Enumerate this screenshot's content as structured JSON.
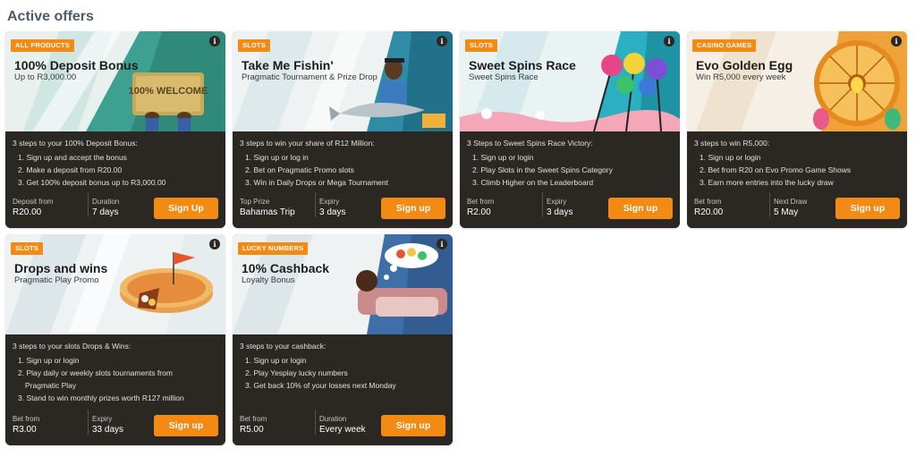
{
  "page": {
    "title": "Active offers"
  },
  "colors": {
    "accent": "#f28a14",
    "card_dark": "#2b2723"
  },
  "offers": [
    {
      "badge": "ALL PRODUCTS",
      "title": "100% Deposit Bonus",
      "subtitle": "Up to R3,000.00",
      "steps_head": "3 steps to your 100% Deposit Bonus:",
      "steps": [
        "1. Sign up and accept the bonus",
        "2. Make a deposit from R20.00",
        "3. Get 100% deposit bonus up to R3,000.00"
      ],
      "meta": [
        {
          "label": "Deposit from",
          "value": "R20.00"
        },
        {
          "label": "Duration",
          "value": "7 days"
        }
      ],
      "cta": "Sign Up",
      "art": "welcome-mat-image",
      "mat_text": "100% WELCOME"
    },
    {
      "badge": "SLOTS",
      "title": "Take Me Fishin'",
      "subtitle": "Pragmatic Tournament & Prize Drop",
      "steps_head": "3 steps to win your share of R12 Million:",
      "steps": [
        "1. Sign up or log in",
        "2. Bet on Pragmatic Promo slots",
        "3. Win in Daily Drops or Mega Tournament"
      ],
      "meta": [
        {
          "label": "Top Prize",
          "value": "Bahamas Trip"
        },
        {
          "label": "Expiry",
          "value": "3 days"
        }
      ],
      "cta": "Sign up",
      "art": "fisherman-image"
    },
    {
      "badge": "SLOTS",
      "title": "Sweet Spins Race",
      "subtitle": "Sweet Spins Race",
      "steps_head": "3 Steps to Sweet Spins Race Victory:",
      "steps": [
        "1. Sign up or login",
        "2. Play Slots in the Sweet Spins Category",
        "3. Climb Higher on the Leaderboard"
      ],
      "meta": [
        {
          "label": "Bet from",
          "value": "R2.00"
        },
        {
          "label": "Expiry",
          "value": "3 days"
        }
      ],
      "cta": "Sign up",
      "art": "lollipops-image"
    },
    {
      "badge": "CASINO GAMES",
      "title": "Evo Golden Egg",
      "subtitle": "Win R5,000 every week",
      "steps_head": "3 steps to win R5,000:",
      "steps": [
        "1. Sign up or login",
        "2. Bet from R20 on Evo Promo Game Shows",
        "3. Earn more entries into the lucky draw"
      ],
      "meta": [
        {
          "label": "Bet from",
          "value": "R20.00"
        },
        {
          "label": "Next Draw",
          "value": "5 May"
        }
      ],
      "cta": "Sign up",
      "art": "golden-egg-wheel-image"
    },
    {
      "badge": "SLOTS",
      "title": "Drops and wins",
      "subtitle": "Pragmatic Play Promo",
      "steps_head": "3 steps to your slots Drops & Wins:",
      "steps": [
        "1. Sign up or login",
        "2. Play daily or weekly slots tournaments from",
        "    Pragmatic Play",
        "3. Stand to win monthly prizes worth R127 million"
      ],
      "meta": [
        {
          "label": "Bet from",
          "value": "R3.00"
        },
        {
          "label": "Expiry",
          "value": "33 days"
        }
      ],
      "cta": "Sign up",
      "art": "pie-image"
    },
    {
      "badge": "LUCKY NUMBERS",
      "title": "10% Cashback",
      "subtitle": "Loyalty Bonus",
      "steps_head": "3 steps to your cashback:",
      "steps": [
        "1. Sign up or login",
        "2. Play Yesplay lucky numbers",
        "3. Get back 10% of your losses next Monday"
      ],
      "meta": [
        {
          "label": "Bet from",
          "value": "R5.00"
        },
        {
          "label": "Duration",
          "value": "Every week"
        }
      ],
      "cta": "Sign up",
      "art": "dreaming-lotto-image"
    }
  ]
}
